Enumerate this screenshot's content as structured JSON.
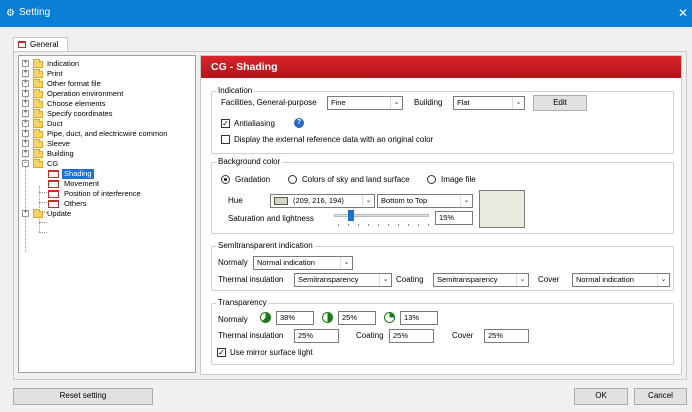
{
  "window": {
    "title": "Setting",
    "close_glyph": "✕"
  },
  "tabs": [
    {
      "label": "General",
      "active": true
    }
  ],
  "tree": {
    "items": [
      {
        "label": "Indication",
        "type": "folder",
        "expander": "+"
      },
      {
        "label": "Print",
        "type": "folder",
        "expander": "+"
      },
      {
        "label": "Other format file",
        "type": "folder",
        "expander": "+"
      },
      {
        "label": "Operation environment",
        "type": "folder",
        "expander": "+"
      },
      {
        "label": "Choose elements",
        "type": "folder",
        "expander": "+"
      },
      {
        "label": "Specify coordinates",
        "type": "folder",
        "expander": "+"
      },
      {
        "label": "Duct",
        "type": "folder",
        "expander": "+"
      },
      {
        "label": "Pipe, duct, and electricwire common",
        "type": "folder",
        "expander": "+"
      },
      {
        "label": "Sleeve",
        "type": "folder",
        "expander": "+"
      },
      {
        "label": "Building",
        "type": "folder",
        "expander": "+"
      },
      {
        "label": "CG",
        "type": "folder",
        "expander": "−"
      },
      {
        "label": "Shading",
        "type": "page",
        "selected": true
      },
      {
        "label": "Movement",
        "type": "page"
      },
      {
        "label": "Position of interference",
        "type": "page"
      },
      {
        "label": "Others",
        "type": "page"
      },
      {
        "label": "Update",
        "type": "folder",
        "expander": "+"
      }
    ]
  },
  "panel": {
    "title": "CG - Shading",
    "indication": {
      "group_label": "Indication",
      "facilities_label": "Facilities, General-purpose",
      "facilities_value": "Fine",
      "building_label": "Building",
      "building_value": "Flat",
      "edit_label": "Edit",
      "antialiasing_label": "Antialiasing",
      "antialiasing_checked": true,
      "help_glyph": "?",
      "external_label": "Display the external reference data with an original color",
      "external_checked": false
    },
    "background": {
      "group_label": "Background color",
      "radio_gradation": "Gradation",
      "radio_sky": "Colors of sky and land surface",
      "radio_image": "Image file",
      "selected": "Gradation",
      "hue_label": "Hue",
      "hue_value": "(209, 216, 194)",
      "hue_color": "#d1d8c2",
      "direction_value": "Bottom to Top",
      "saturation_label": "Saturation and lightness",
      "saturation_value": "15%",
      "saturation_level": 0.15,
      "preview_color": "#e8ecdf"
    },
    "semitransparent": {
      "group_label": "Semitransparent indication",
      "normaly_label": "Normaly",
      "normaly_value": "Normal indication",
      "thermal_label": "Thermal insulation",
      "thermal_value": "Semitransparency",
      "coating_label": "Coating",
      "coating_value": "Semitransparency",
      "cover_label": "Cover",
      "cover_value": "Normal indication"
    },
    "transparency": {
      "group_label": "Transparency",
      "normaly_label": "Normaly",
      "values": [
        "38%",
        "25%",
        "13%"
      ],
      "thermal_label": "Thermal insulation",
      "thermal_value": "25%",
      "coating_label": "Coating",
      "coating_value": "25%",
      "cover_label": "Cover",
      "cover_value": "25%",
      "mirror_label": "Use mirror surface light",
      "mirror_checked": true
    }
  },
  "footer": {
    "reset_label": "Reset setting",
    "ok_label": "OK",
    "cancel_label": "Cancel"
  },
  "colors": {
    "titlebar": "#0a7fd6",
    "header": "#c81c22",
    "selection": "#1a73d1"
  }
}
